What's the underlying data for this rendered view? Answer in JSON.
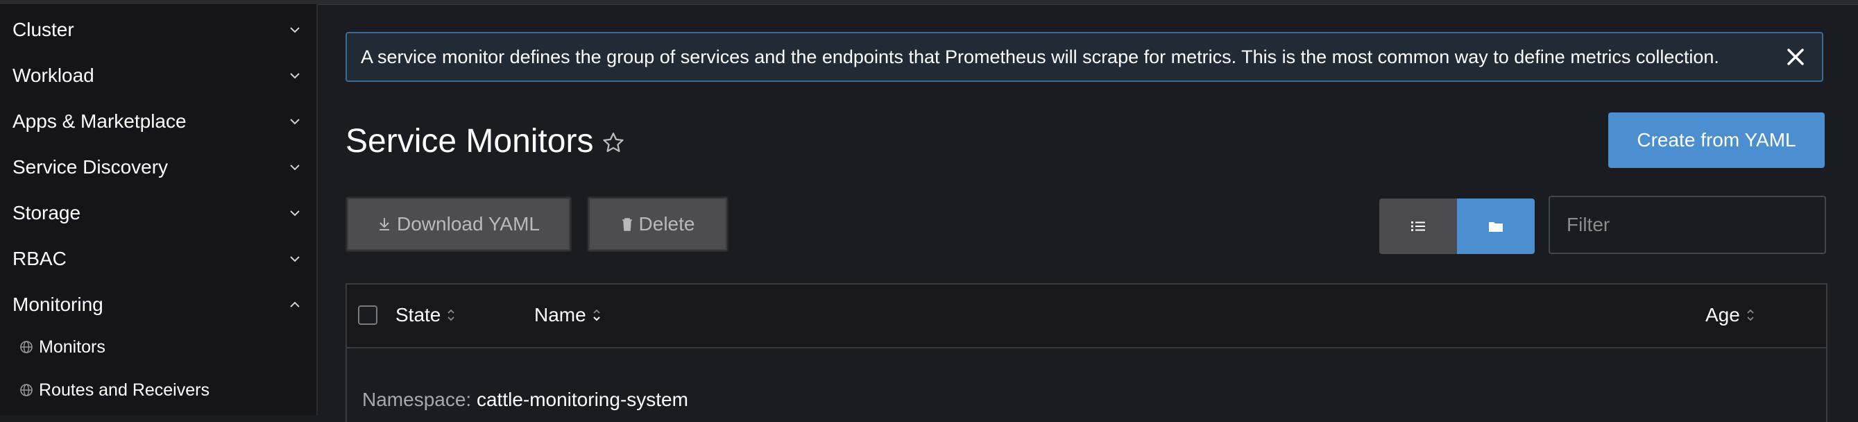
{
  "sidebar": {
    "groups": [
      {
        "label": "Cluster",
        "expanded": false
      },
      {
        "label": "Workload",
        "expanded": false
      },
      {
        "label": "Apps & Marketplace",
        "expanded": false
      },
      {
        "label": "Service Discovery",
        "expanded": false
      },
      {
        "label": "Storage",
        "expanded": false
      },
      {
        "label": "RBAC",
        "expanded": false
      },
      {
        "label": "Monitoring",
        "expanded": true
      }
    ],
    "monitoring_items": [
      {
        "label": "Monitors",
        "icon": "globe-icon"
      },
      {
        "label": "Routes and Receivers",
        "icon": "globe-icon"
      }
    ]
  },
  "banner": {
    "text": "A service monitor defines the group of services and the endpoints that Prometheus will scrape for metrics. This is the most common way to define metrics collection.",
    "close_icon": "close-icon"
  },
  "header": {
    "title": "Service Monitors",
    "favorite_icon": "star-outline-icon",
    "create_button": "Create from YAML"
  },
  "toolbar": {
    "download_button": "Download YAML",
    "delete_button": "Delete",
    "view_list_icon": "list-icon",
    "view_group_icon": "folder-icon",
    "filter_placeholder": "Filter"
  },
  "table": {
    "columns": [
      "State",
      "Name",
      "Age"
    ],
    "groups": [
      {
        "namespace_label": "Namespace:",
        "namespace_value": "cattle-monitoring-system"
      }
    ]
  },
  "colors": {
    "accent": "#4b8fd1",
    "background": "#1b1c21",
    "sidebar": "#141419",
    "banner_border": "#3a6d96"
  }
}
